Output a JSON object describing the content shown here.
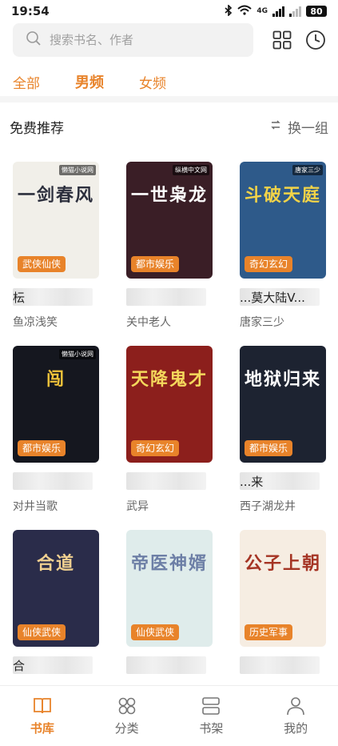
{
  "status_bar": {
    "time": "19:54",
    "network": "4G",
    "battery": "80"
  },
  "search": {
    "placeholder": "搜索书名、作者"
  },
  "tabs": [
    {
      "label": "全部",
      "active": false
    },
    {
      "label": "男频",
      "active": true
    },
    {
      "label": "女频",
      "active": false
    }
  ],
  "section": {
    "title": "免费推荐",
    "refresh_label": "换一组"
  },
  "books": [
    {
      "cover_text": "一剑春风",
      "publisher": "懒猫小说网",
      "tag": "武侠仙侠",
      "title_visible": "枟",
      "author": "鱼凉浅笑",
      "cover_bg": "#f1efe9",
      "cover_fg": "#2c2f3d"
    },
    {
      "cover_text": "一世枭龙",
      "publisher": "纵横中文网",
      "tag": "都市娱乐",
      "title_visible": "",
      "author": "关中老人",
      "cover_bg": "#3a1e26",
      "cover_fg": "#ffffff"
    },
    {
      "cover_text": "斗破天庭",
      "publisher": "唐家三少",
      "tag": "奇幻玄幻",
      "title_visible": "...莫大陆V...",
      "author": "唐家三少",
      "cover_bg": "#2e5a8a",
      "cover_fg": "#f2d348"
    },
    {
      "cover_text": "闯",
      "publisher": "懒猫小说网",
      "tag": "都市娱乐",
      "title_visible": "",
      "author": "对井当歌",
      "cover_bg": "#15171f",
      "cover_fg": "#f1c33a"
    },
    {
      "cover_text": "天降鬼才",
      "publisher": "",
      "tag": "奇幻玄幻",
      "title_visible": "",
      "author": "武异",
      "cover_bg": "#8c1f1c",
      "cover_fg": "#f4d85c"
    },
    {
      "cover_text": "地狱归来",
      "publisher": "",
      "tag": "都市娱乐",
      "title_visible": "...来",
      "author": "西子湖龙井",
      "cover_bg": "#1d2331",
      "cover_fg": "#ffffff"
    },
    {
      "cover_text": "合道",
      "publisher": "",
      "tag": "仙侠武侠",
      "title_visible": "合",
      "author": "",
      "cover_bg": "#2a2c4a",
      "cover_fg": "#f0d090"
    },
    {
      "cover_text": "帝医神婿",
      "publisher": "",
      "tag": "仙侠武侠",
      "title_visible": "",
      "author": "",
      "cover_bg": "#dfeceb",
      "cover_fg": "#6d7fa6"
    },
    {
      "cover_text": "公子上朝",
      "publisher": "",
      "tag": "历史军事",
      "title_visible": "",
      "author": "",
      "cover_bg": "#f6ede2",
      "cover_fg": "#a53424"
    }
  ],
  "bottom_nav": [
    {
      "label": "书库",
      "icon": "book-icon",
      "active": true
    },
    {
      "label": "分类",
      "icon": "category-icon",
      "active": false
    },
    {
      "label": "书架",
      "icon": "shelf-icon",
      "active": false
    },
    {
      "label": "我的",
      "icon": "person-icon",
      "active": false
    }
  ],
  "colors": {
    "accent": "#e8832a",
    "tag_bg": "#e8832a",
    "search_bg": "#f2f2f2"
  }
}
